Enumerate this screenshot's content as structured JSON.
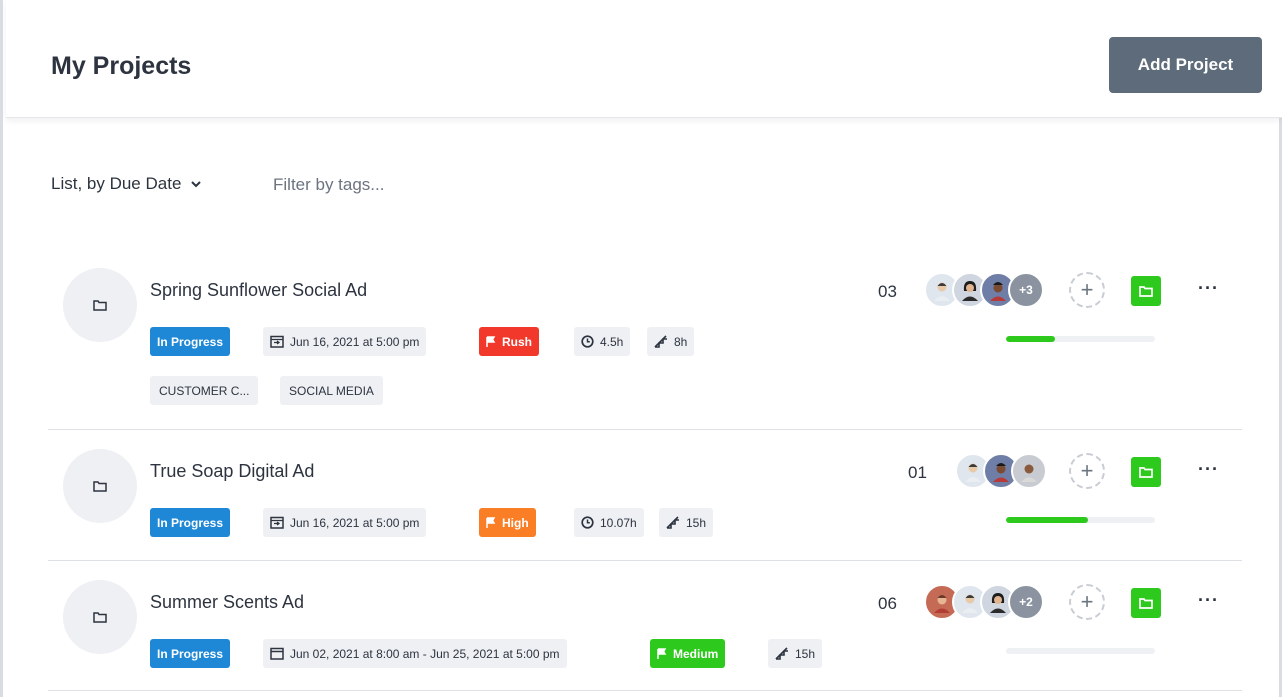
{
  "header": {
    "title": "My Projects",
    "add_label": "Add Project"
  },
  "toolbar": {
    "view_label": "List, by Due Date",
    "filter_placeholder": "Filter by tags..."
  },
  "projects": [
    {
      "name": "Spring Sunflower Social Ad",
      "status": "In Progress",
      "due": "Jun 16, 2021 at 5:00 pm",
      "priority": "Rush",
      "time_logged": "4.5h",
      "estimate": "8h",
      "tags": [
        "CUSTOMER C...",
        "SOCIAL MEDIA"
      ],
      "count": "03",
      "extra_members": "+3",
      "progress": 0.33
    },
    {
      "name": "True Soap Digital Ad",
      "status": "In Progress",
      "due": "Jun 16, 2021 at 5:00 pm",
      "priority": "High",
      "time_logged": "10.07h",
      "estimate": "15h",
      "tags": [],
      "count": "01",
      "extra_members": "",
      "progress": 0.55
    },
    {
      "name": "Summer Scents Ad",
      "status": "In Progress",
      "due": "Jun 02, 2021 at 8:00 am - Jun 25, 2021 at 5:00 pm",
      "priority": "Medium",
      "time_logged": "",
      "estimate": "15h",
      "tags": [],
      "count": "06",
      "extra_members": "+2",
      "progress": 0.0
    }
  ],
  "colors": {
    "status_blue": "#1e88d6",
    "rush_red": "#f2382a",
    "high_orange": "#f97e26",
    "medium_green": "#2ec91d",
    "button_grey": "#5e6b7a"
  }
}
